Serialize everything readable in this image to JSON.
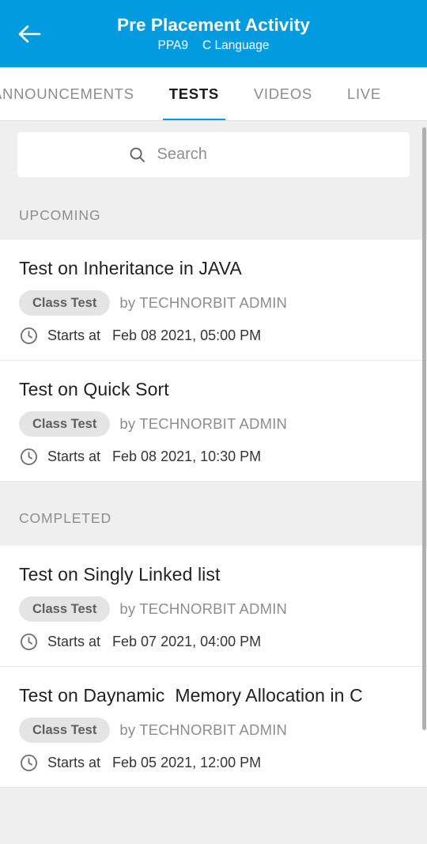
{
  "appbar": {
    "back_icon": "arrow-left-icon",
    "title": "Pre Placement Activity",
    "subtitle_code": "PPA9",
    "subtitle_course": "C Language",
    "background_color": "#039BE0"
  },
  "tabs": [
    {
      "label": "ANNOUNCEMENTS",
      "active": false
    },
    {
      "label": "TESTS",
      "active": true
    },
    {
      "label": "VIDEOS",
      "active": false
    },
    {
      "label": "LIVE",
      "active": false
    }
  ],
  "search": {
    "icon": "search-icon",
    "placeholder": "Search",
    "value": ""
  },
  "sections": [
    {
      "header": "UPCOMING",
      "items": [
        {
          "title": "Test on Inheritance in JAVA",
          "badge": "Class Test",
          "author": "by TECHNORBIT ADMIN",
          "time_icon": "clock-icon",
          "time_label": "Starts at",
          "time_value": "Feb 08 2021, 05:00 PM"
        },
        {
          "title": "Test on Quick Sort",
          "badge": "Class Test",
          "author": "by TECHNORBIT ADMIN",
          "time_icon": "clock-icon",
          "time_label": "Starts at",
          "time_value": "Feb 08 2021, 10:30 PM"
        }
      ]
    },
    {
      "header": "COMPLETED",
      "items": [
        {
          "title": "Test on Singly Linked list",
          "badge": "Class Test",
          "author": "by TECHNORBIT ADMIN",
          "time_icon": "clock-icon",
          "time_label": "Starts at",
          "time_value": "Feb 07 2021, 04:00 PM"
        },
        {
          "title": "Test on Daynamic  Memory Allocation in C",
          "badge": "Class Test",
          "author": "by TECHNORBIT ADMIN",
          "time_icon": "clock-icon",
          "time_label": "Starts at",
          "time_value": "Feb 05 2021, 12:00 PM"
        }
      ]
    }
  ],
  "colors": {
    "accent": "#039BE0",
    "page_background": "#EFEFEF",
    "card_background": "#FFFFFF",
    "badge_background": "#E4E4E4",
    "muted_text": "#8D8D8D"
  }
}
